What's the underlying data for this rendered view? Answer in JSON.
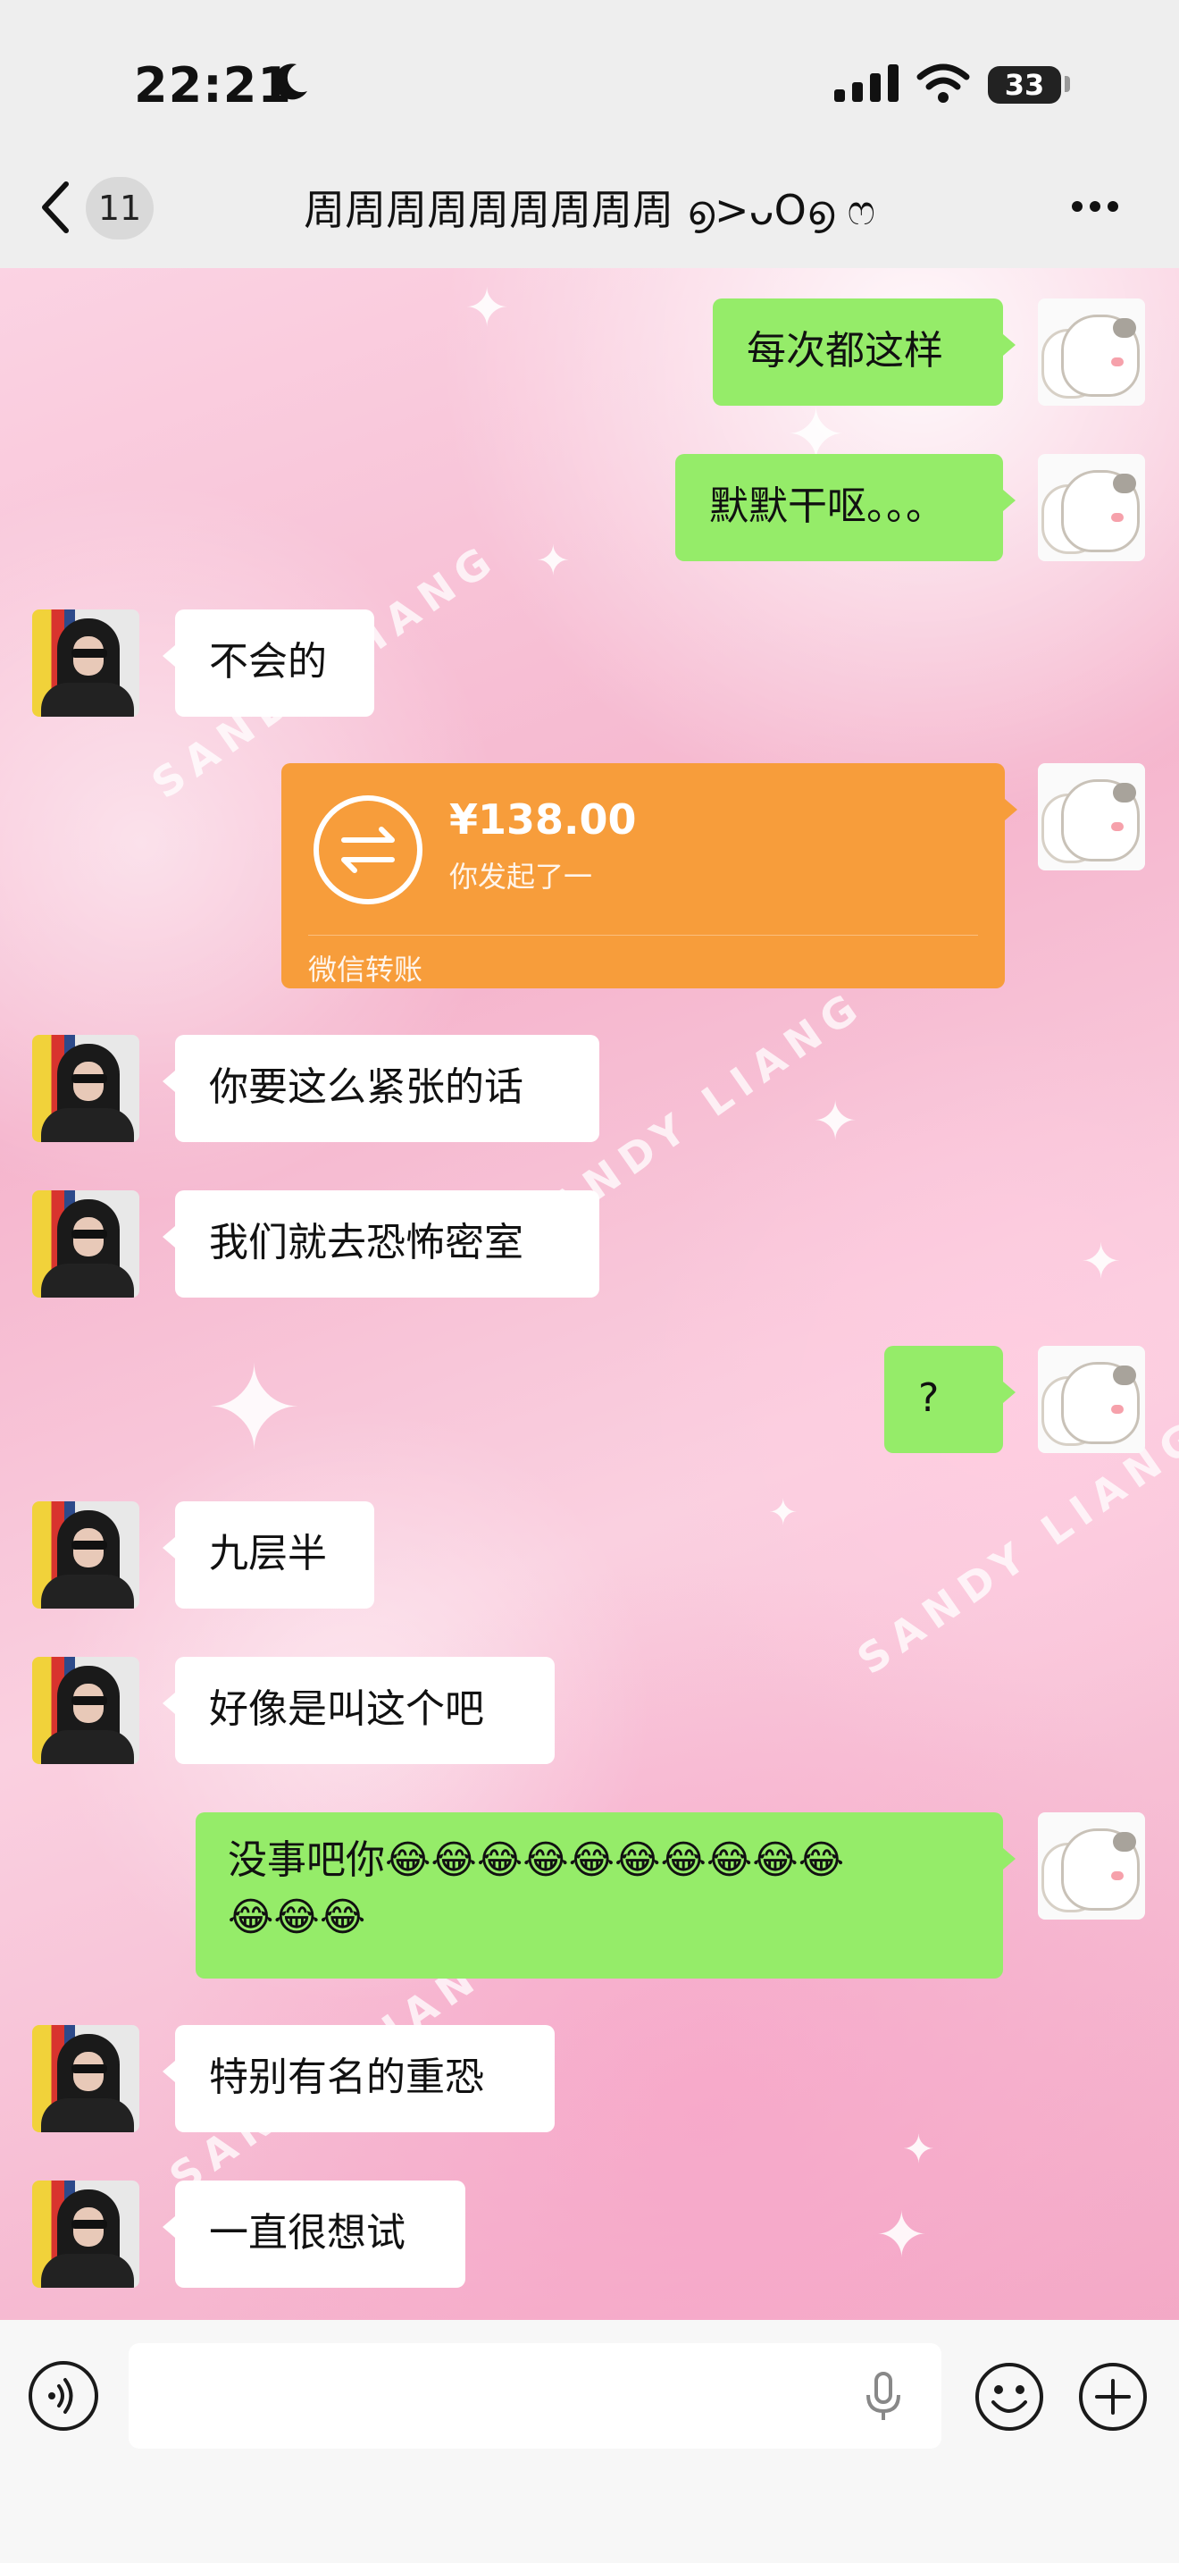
{
  "status_bar": {
    "time": "22:21",
    "battery": "33",
    "icons": [
      "moon-icon",
      "signal-icon",
      "wifi-icon",
      "battery-icon"
    ]
  },
  "header": {
    "back_icon": "chevron-left-icon",
    "unread_count": "11",
    "title": "周周周周周周周周周 ൭>ᴗO൭ ෆ",
    "more_icon": "more-dots-icon"
  },
  "watermark_text": "SANDY LIANG",
  "messages": [
    {
      "side": "right",
      "text": "每次都这样"
    },
    {
      "side": "right",
      "text": "默默干呕。。。"
    },
    {
      "side": "left",
      "text": "不会的"
    },
    {
      "side": "right",
      "type": "transfer"
    },
    {
      "side": "left",
      "text": "你要这么紧张的话"
    },
    {
      "side": "left",
      "text": "我们就去恐怖密室"
    },
    {
      "side": "right",
      "text": "?"
    },
    {
      "side": "left",
      "text": "九层半"
    },
    {
      "side": "left",
      "text": "好像是叫这个吧"
    },
    {
      "side": "right",
      "text": "没事吧你😂😂😂😂😂😂😂😂😂😂",
      "text_line2": "😂😂😂"
    },
    {
      "side": "left",
      "text": "特别有名的重恐"
    },
    {
      "side": "left",
      "text": "一直很想试"
    }
  ],
  "transfer": {
    "amount": "¥138.00",
    "note": "你发起了一",
    "label": "微信转账",
    "color": "#f79d3b"
  },
  "bottom_bar": {
    "input_value": "",
    "icons": [
      "voice-icon",
      "microphone-icon",
      "emoji-icon",
      "plus-icon"
    ]
  },
  "colors": {
    "self_bubble": "#95ec69",
    "other_bubble": "#ffffff"
  }
}
